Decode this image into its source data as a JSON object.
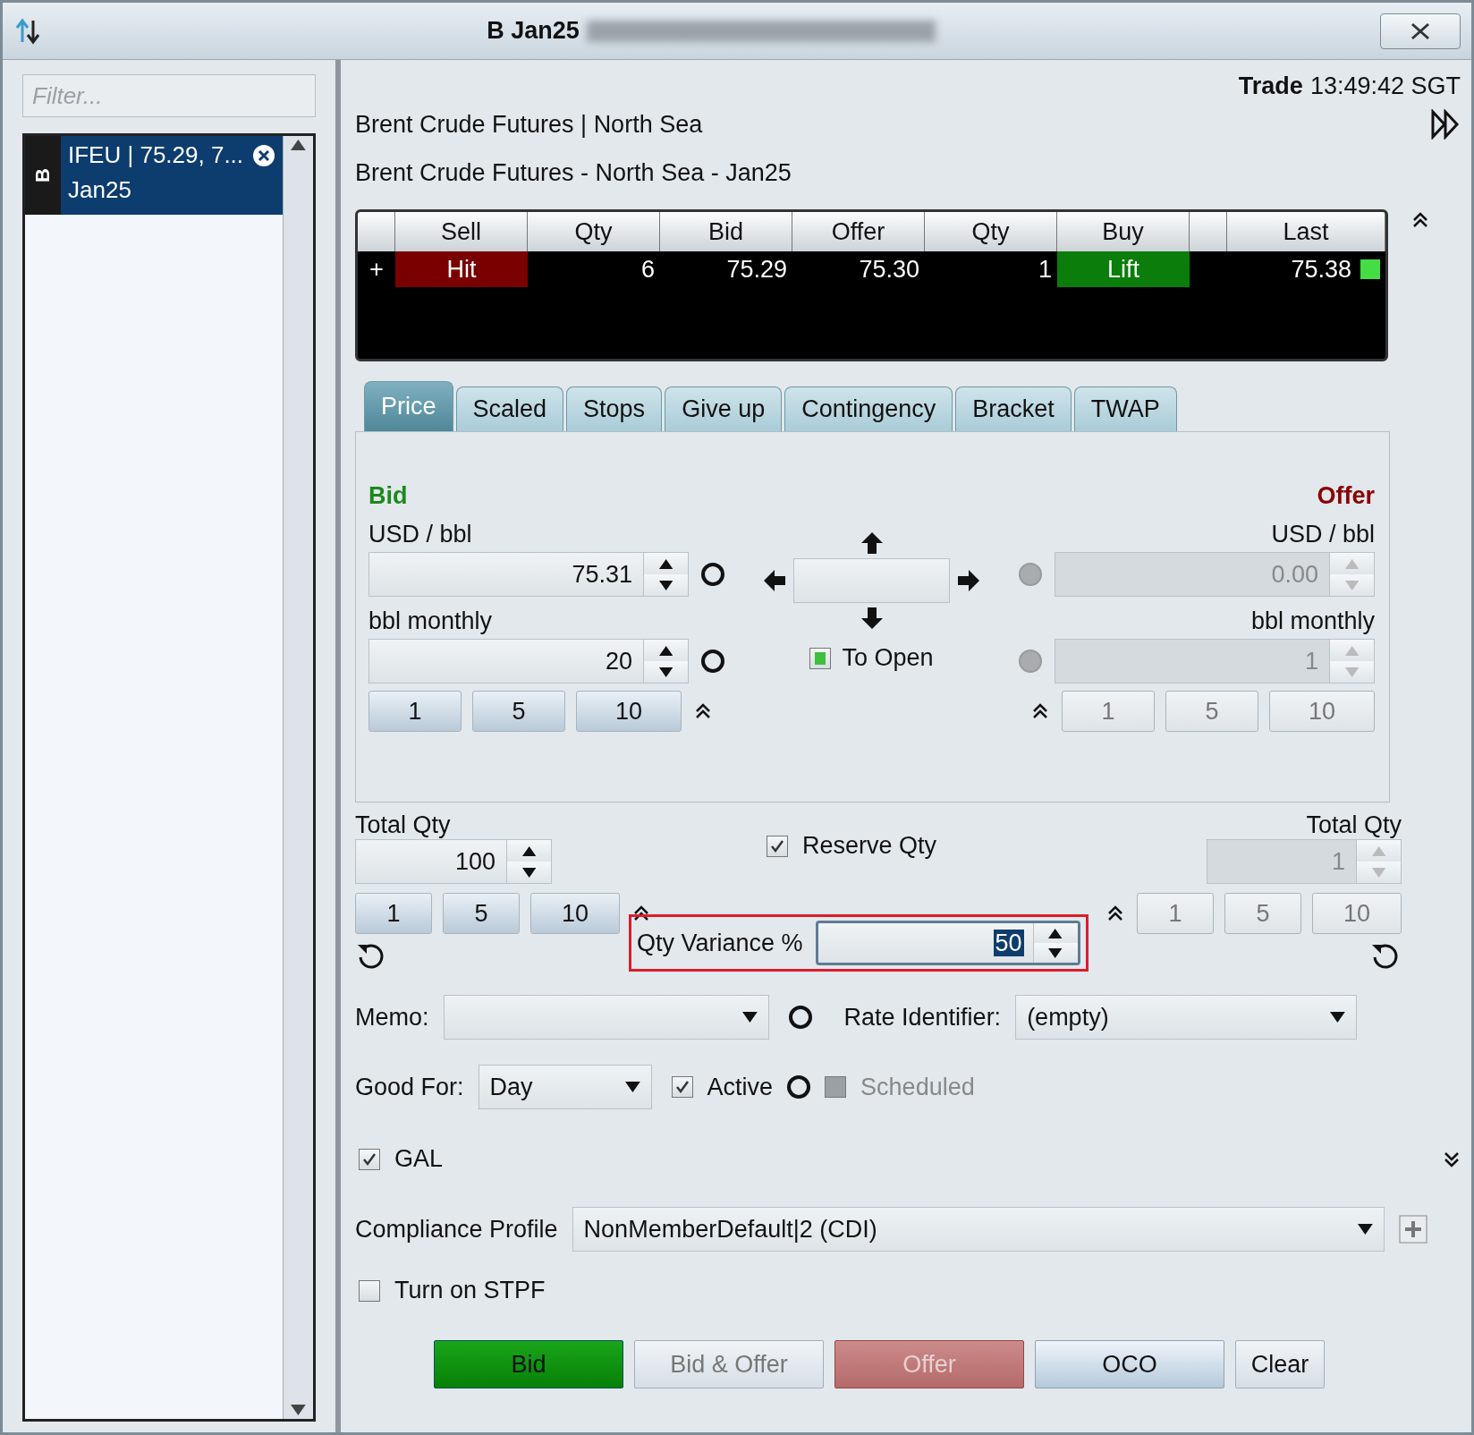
{
  "window": {
    "title": "B Jan25"
  },
  "filter": {
    "placeholder": "Filter..."
  },
  "sidebar": {
    "items": [
      {
        "tag": "B",
        "name": "IFEU | 75.29, 7...",
        "contract": "Jan25",
        "selected": true
      }
    ]
  },
  "trade_time": {
    "label": "Trade",
    "time": "13:49:42 SGT"
  },
  "headings": [
    "Brent Crude Futures | North Sea",
    "Brent Crude Futures - North Sea - Jan25"
  ],
  "market": {
    "columns": [
      "Sell",
      "Qty",
      "Bid",
      "Offer",
      "Qty",
      "Buy",
      "Last"
    ],
    "rows": [
      {
        "expander": "+",
        "sell": "Hit",
        "bid_qty": "6",
        "bid": "75.29",
        "offer": "75.30",
        "offer_qty": "1",
        "buy": "Lift",
        "last": "75.38"
      }
    ]
  },
  "tabs": [
    {
      "label": "Price",
      "selected": true
    },
    {
      "label": "Scaled",
      "selected": false
    },
    {
      "label": "Stops",
      "selected": false
    },
    {
      "label": "Give up",
      "selected": false
    },
    {
      "label": "Contingency",
      "selected": false
    },
    {
      "label": "Bracket",
      "selected": false
    },
    {
      "label": "TWAP",
      "selected": false
    }
  ],
  "sides": [
    {
      "kind": "bid",
      "title": "Bid",
      "price_label": "USD / bbl",
      "price": "75.31",
      "qty_label": "bbl monthly",
      "qty": "20",
      "disabled": false,
      "radios": [
        {
          "selected": false
        },
        {
          "selected": false
        }
      ],
      "increments": [
        "1",
        "5",
        "10"
      ]
    },
    {
      "kind": "offer",
      "title": "Offer",
      "price_label": "USD / bbl",
      "price": "0.00",
      "qty_label": "bbl monthly",
      "qty": "1",
      "disabled": true,
      "radios": [
        {
          "selected": false
        },
        {
          "selected": false
        }
      ],
      "increments": [
        "1",
        "5",
        "10"
      ]
    }
  ],
  "to_open": {
    "label": "To Open",
    "checked": true
  },
  "total_qty": [
    {
      "label": "Total Qty",
      "value": "100",
      "disabled": false,
      "increments": [
        "1",
        "5",
        "10"
      ]
    },
    {
      "label": "Total Qty",
      "value": "1",
      "disabled": true,
      "increments": [
        "1",
        "5",
        "10"
      ]
    }
  ],
  "reserve_qty": {
    "label": "Reserve Qty",
    "checked": true
  },
  "qty_variance": {
    "label": "Qty Variance %",
    "value": "50"
  },
  "memo": {
    "label": "Memo:",
    "radio": {
      "selected": false
    }
  },
  "rate_identifier": {
    "label": "Rate Identifier:",
    "value": "(empty)"
  },
  "good_for": {
    "label": "Good For:",
    "value": "Day",
    "radio": {
      "selected": false
    }
  },
  "active": {
    "label": "Active",
    "checked": true
  },
  "scheduled": {
    "label": "Scheduled",
    "checked": false,
    "disabled": true
  },
  "gal": {
    "label": "GAL",
    "checked": true
  },
  "compliance": {
    "label": "Compliance Profile",
    "value": "NonMemberDefault|2 (CDI)"
  },
  "stpf": {
    "label": "Turn on STPF",
    "checked": false
  },
  "buttons": [
    {
      "label": "Bid",
      "kind": "bid",
      "disabled": false
    },
    {
      "label": "Bid & Offer",
      "kind": "plain",
      "disabled": true
    },
    {
      "label": "Offer",
      "kind": "offer",
      "disabled": true
    },
    {
      "label": "OCO",
      "kind": "blue",
      "disabled": false
    },
    {
      "label": "Clear",
      "kind": "plain",
      "disabled": false
    }
  ]
}
